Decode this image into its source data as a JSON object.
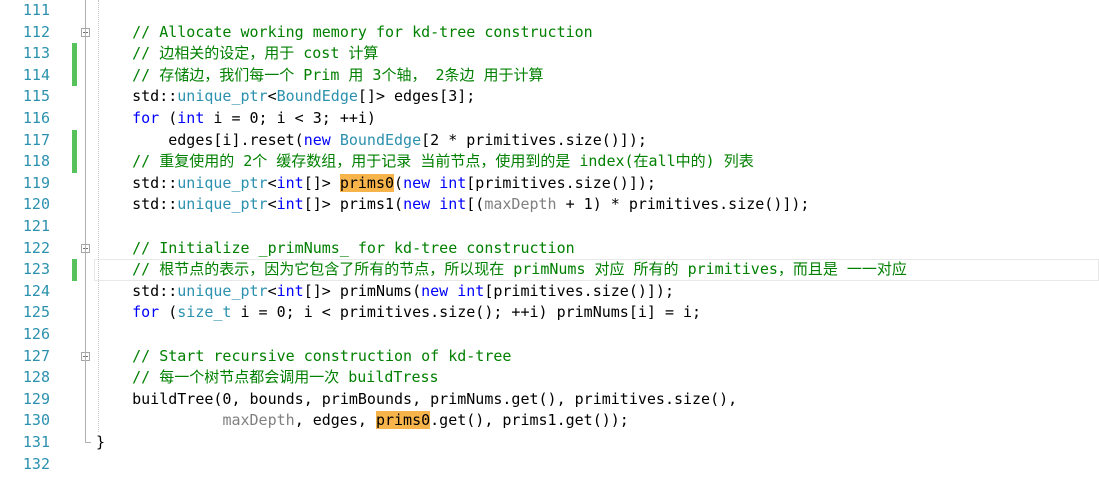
{
  "editor": {
    "line_numbers": [
      "111",
      "112",
      "113",
      "114",
      "115",
      "116",
      "117",
      "118",
      "119",
      "120",
      "121",
      "122",
      "123",
      "124",
      "125",
      "126",
      "127",
      "128",
      "129",
      "130",
      "131",
      "132"
    ],
    "fold_markers": [
      {
        "line": "112",
        "state": "expanded"
      },
      {
        "line": "122",
        "state": "expanded"
      },
      {
        "line": "127",
        "state": "expanded"
      }
    ],
    "changed_lines": [
      "113",
      "114",
      "117",
      "118",
      "123"
    ],
    "lines": [
      [],
      [
        {
          "t": "    "
        },
        {
          "t": "// Allocate working memory for kd-tree construction",
          "s": "c"
        }
      ],
      [
        {
          "t": "    "
        },
        {
          "t": "// 边相关的设定，用于 cost 计算",
          "s": "c"
        }
      ],
      [
        {
          "t": "    "
        },
        {
          "t": "// 存储边，我们每一个 Prim 用 3个轴， 2条边 用于计算",
          "s": "c"
        }
      ],
      [
        {
          "t": "    std::"
        },
        {
          "t": "unique_ptr",
          "s": "t"
        },
        {
          "t": "<"
        },
        {
          "t": "BoundEdge",
          "s": "t"
        },
        {
          "t": "[]> edges[3];"
        }
      ],
      [
        {
          "t": "    "
        },
        {
          "t": "for",
          "s": "k"
        },
        {
          "t": " ("
        },
        {
          "t": "int",
          "s": "k"
        },
        {
          "t": " i = 0; i < 3; ++i)"
        }
      ],
      [
        {
          "t": "        edges[i].reset("
        },
        {
          "t": "new",
          "s": "k"
        },
        {
          "t": " "
        },
        {
          "t": "BoundEdge",
          "s": "t"
        },
        {
          "t": "[2 * primitives.size()]);"
        }
      ],
      [
        {
          "t": "    "
        },
        {
          "t": "// 重复使用的 2个 缓存数组，用于记录 当前节点，使用到的是 index(在all中的) 列表",
          "s": "c"
        }
      ],
      [
        {
          "t": "    std::"
        },
        {
          "t": "unique_ptr",
          "s": "t"
        },
        {
          "t": "<"
        },
        {
          "t": "int",
          "s": "k"
        },
        {
          "t": "[]> "
        },
        {
          "t": "prims0",
          "s": "hl"
        },
        {
          "t": "("
        },
        {
          "t": "new",
          "s": "k"
        },
        {
          "t": " "
        },
        {
          "t": "int",
          "s": "k"
        },
        {
          "t": "[primitives.size()]);"
        }
      ],
      [
        {
          "t": "    std::"
        },
        {
          "t": "unique_ptr",
          "s": "t"
        },
        {
          "t": "<"
        },
        {
          "t": "int",
          "s": "k"
        },
        {
          "t": "[]> prims1("
        },
        {
          "t": "new",
          "s": "k"
        },
        {
          "t": " "
        },
        {
          "t": "int",
          "s": "k"
        },
        {
          "t": "[("
        },
        {
          "t": "maxDepth",
          "s": "v"
        },
        {
          "t": " + 1) * primitives.size()]);"
        }
      ],
      [],
      [
        {
          "t": "    "
        },
        {
          "t": "// Initialize _primNums_ for kd-tree construction",
          "s": "c"
        }
      ],
      [
        {
          "t": "    "
        },
        {
          "t": "// 根节点的表示，因为它包含了所有的节点，所以现在 primNums 对应 所有的 primitives，而且是 一一对应",
          "s": "c"
        }
      ],
      [
        {
          "t": "    std::"
        },
        {
          "t": "unique_ptr",
          "s": "t"
        },
        {
          "t": "<"
        },
        {
          "t": "int",
          "s": "k"
        },
        {
          "t": "[]> primNums("
        },
        {
          "t": "new",
          "s": "k"
        },
        {
          "t": " "
        },
        {
          "t": "int",
          "s": "k"
        },
        {
          "t": "[primitives.size()]);"
        }
      ],
      [
        {
          "t": "    "
        },
        {
          "t": "for",
          "s": "k"
        },
        {
          "t": " ("
        },
        {
          "t": "size_t",
          "s": "t"
        },
        {
          "t": " i = 0; i < primitives.size(); ++i) primNums[i] = i;"
        }
      ],
      [],
      [
        {
          "t": "    "
        },
        {
          "t": "// Start recursive construction of kd-tree",
          "s": "c"
        }
      ],
      [
        {
          "t": "    "
        },
        {
          "t": "// 每一个树节点都会调用一次 buildTress",
          "s": "c"
        }
      ],
      [
        {
          "t": "    buildTree(0, bounds, primBounds, primNums.get(), primitives.size(),"
        }
      ],
      [
        {
          "t": "              "
        },
        {
          "t": "maxDepth",
          "s": "v"
        },
        {
          "t": ", edges, "
        },
        {
          "t": "prims0",
          "s": "hl"
        },
        {
          "t": ".get(), prims1.get());"
        }
      ],
      [
        {
          "t": "}"
        }
      ],
      []
    ]
  }
}
